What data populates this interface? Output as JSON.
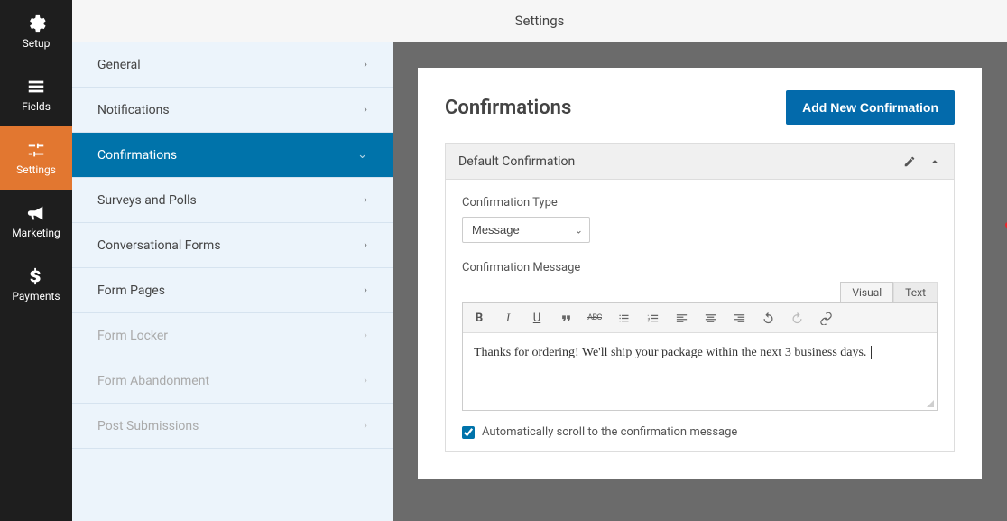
{
  "header": {
    "title": "Settings"
  },
  "iconSidebar": {
    "items": [
      {
        "name": "setup",
        "label": "Setup"
      },
      {
        "name": "fields",
        "label": "Fields"
      },
      {
        "name": "settings",
        "label": "Settings"
      },
      {
        "name": "marketing",
        "label": "Marketing"
      },
      {
        "name": "payments",
        "label": "Payments"
      }
    ]
  },
  "submenu": {
    "items": [
      {
        "label": "General",
        "chevron": "right",
        "state": "default"
      },
      {
        "label": "Notifications",
        "chevron": "right",
        "state": "default"
      },
      {
        "label": "Confirmations",
        "chevron": "down",
        "state": "active"
      },
      {
        "label": "Surveys and Polls",
        "chevron": "right",
        "state": "default"
      },
      {
        "label": "Conversational Forms",
        "chevron": "right",
        "state": "default"
      },
      {
        "label": "Form Pages",
        "chevron": "right",
        "state": "default"
      },
      {
        "label": "Form Locker",
        "chevron": "right",
        "state": "disabled"
      },
      {
        "label": "Form Abandonment",
        "chevron": "right",
        "state": "disabled"
      },
      {
        "label": "Post Submissions",
        "chevron": "right",
        "state": "disabled"
      }
    ]
  },
  "panel": {
    "title": "Confirmations",
    "addButton": "Add New Confirmation"
  },
  "confirmation": {
    "blockTitle": "Default Confirmation",
    "typeLabel": "Confirmation Type",
    "typeValue": "Message",
    "messageLabel": "Confirmation Message",
    "messageContent": "Thanks for ordering! We'll ship your package within the next 3 business days.",
    "tabs": {
      "visual": "Visual",
      "text": "Text"
    },
    "scrollCheckbox": "Automatically scroll to the confirmation message",
    "scrollChecked": true
  },
  "toolbar": {
    "buttons": [
      "bold",
      "italic",
      "underline",
      "blockquote",
      "strikethrough",
      "ul",
      "ol",
      "alignleft",
      "aligncenter",
      "alignright",
      "undo",
      "redo",
      "link"
    ]
  }
}
